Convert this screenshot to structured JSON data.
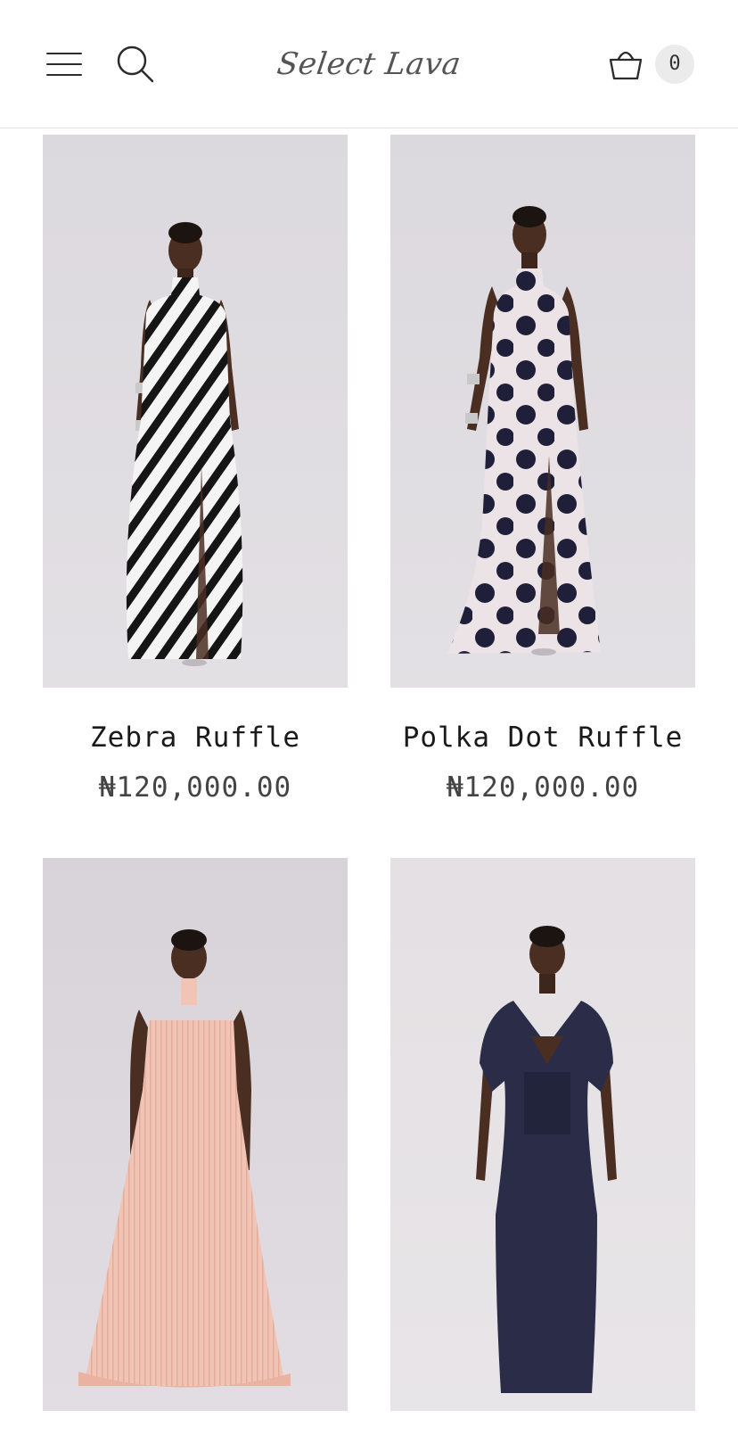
{
  "header": {
    "brand": "Select Lava",
    "cart_count": "0",
    "icons": {
      "menu": "hamburger-menu-icon",
      "search": "search-icon",
      "cart": "shopping-basket-icon"
    }
  },
  "products": [
    {
      "name": "Zebra Ruffle",
      "price": "₦120,000.00",
      "dress_color": "#1c1c1c",
      "pattern": "zebra"
    },
    {
      "name": "Polka Dot Ruffle",
      "price": "₦120,000.00",
      "dress_color": "#ece3e6",
      "pattern": "polka-dot"
    },
    {
      "name": "",
      "price": "",
      "dress_color": "#f2c4b5",
      "pattern": "pleated"
    },
    {
      "name": "",
      "price": "",
      "dress_color": "#2a2c48",
      "pattern": "plain"
    }
  ],
  "colors": {
    "photo_background": "#dcd8dd",
    "skin": "#4a2e22"
  }
}
